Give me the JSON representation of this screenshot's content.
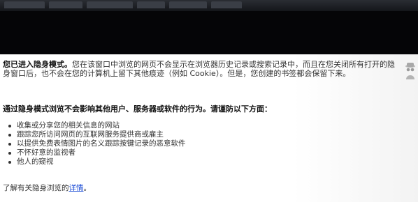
{
  "intro": {
    "lead": "您已进入隐身模式。",
    "rest": "您在该窗口中浏览的网页不会显示在浏览器历史记录或搜索记录中，而且在您关闭所有打开的隐身窗口后，也不会在您的计算机上留下其他痕迹（例如 Cookie）。但是，您创建的书签都会保留下来。"
  },
  "heading": "通过隐身模式浏览不会影响其他用户、服务器或软件的行为。请谨防以下方面：",
  "bullets": [
    "收集或分享您的相关信息的网站",
    "跟踪您所访问网页的互联网服务提供商或雇主",
    "以提供免费表情图片的名义跟踪按键记录的恶意软件",
    "不怀好意的监视者",
    "他人的窥视"
  ],
  "footer": {
    "prefix": "了解有关隐身浏览的",
    "link": "详情",
    "suffix": "。"
  },
  "icons": {
    "incognito": "incognito-icon"
  },
  "colors": {
    "topbar": "#050507",
    "link": "#1a4bd6"
  }
}
